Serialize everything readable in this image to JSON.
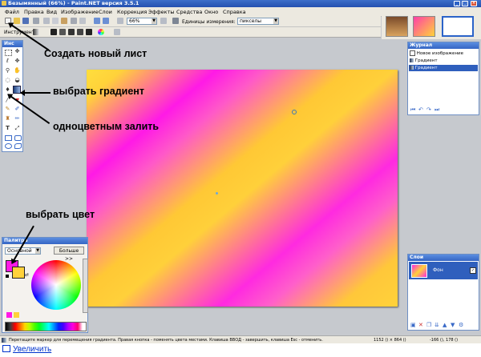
{
  "window": {
    "title": "Безымянный (66%) - Paint.NET версия 3.5.1"
  },
  "menu": [
    "Файл",
    "Правка",
    "Вид",
    "Изображение",
    "Слои",
    "Коррекция",
    "Эффекты",
    "Средства",
    "Окно",
    "Справка"
  ],
  "toolbar": {
    "zoom": "66%",
    "units_label": "Единицы измерения:",
    "units_value": "пикселы"
  },
  "tool_options": {
    "tool_label": "Инструмент:"
  },
  "tools_panel": {
    "title": "Инс"
  },
  "history_panel": {
    "title": "Журнал",
    "items": [
      "Новое изображение",
      "Градиент",
      "Градиент"
    ]
  },
  "layers_panel": {
    "title": "Слои",
    "layer_name": "Фон"
  },
  "palette_panel": {
    "title": "Палитра",
    "mode_value": "Основной",
    "more_button": "Больше >>"
  },
  "annotations": {
    "new_sheet": "Создать новый лист",
    "select_gradient": "выбрать градиент",
    "solid_fill": "одноцветным залить",
    "select_color": "выбрать цвет"
  },
  "statusbar": {
    "hint": "Перетащите маркер для перемещения градиента. Правая кнопка - поменять цвета местами. Клавиша ВВОД - завершить, клавиша Esc - отменить.",
    "size": "1152 () × 864 ()",
    "coords": "-166 (), 178 ()"
  },
  "colors": {
    "primary": "#ff1ae6",
    "secondary": "#ffd23a",
    "title_bar": "#2450b0"
  },
  "footer_link": "Увеличить"
}
